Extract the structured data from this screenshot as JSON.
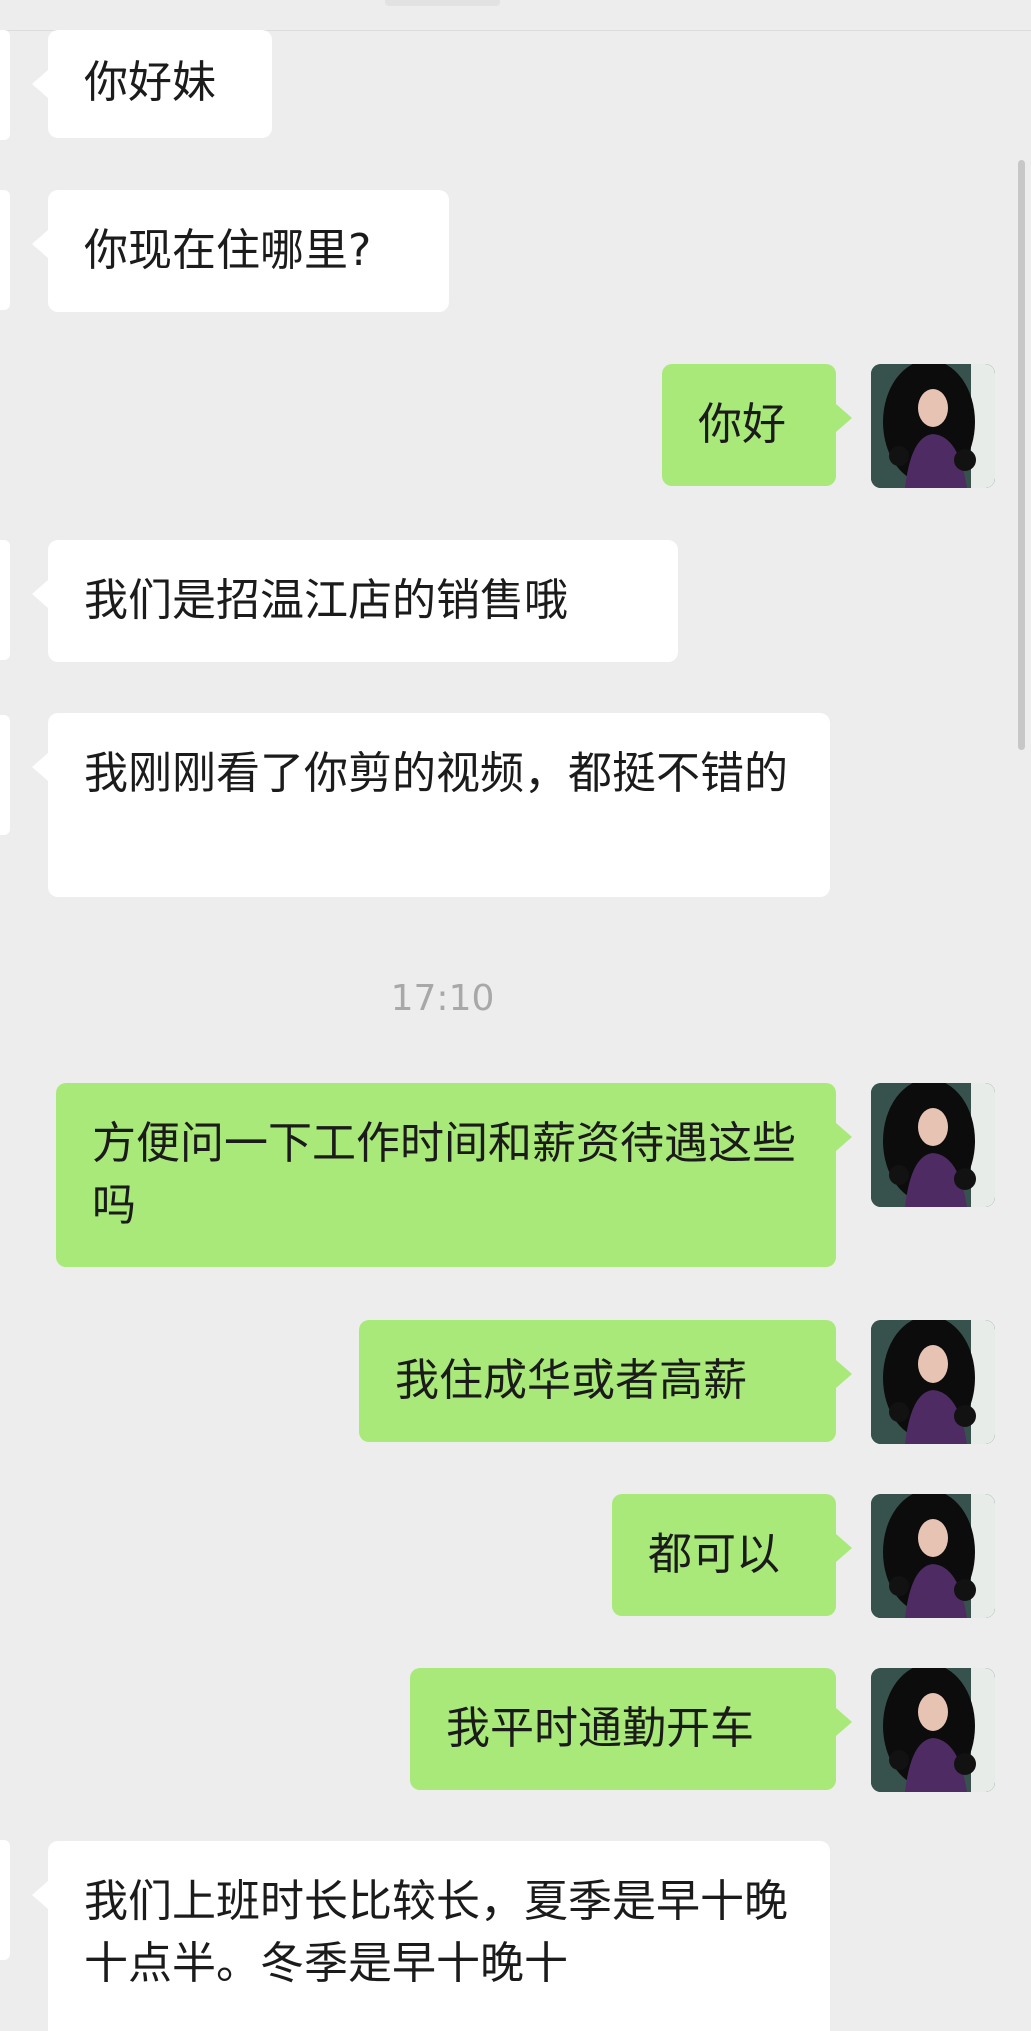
{
  "chat": {
    "messages": [
      {
        "side": "left",
        "text": "你好妹"
      },
      {
        "side": "left",
        "text": "你现在住哪里?"
      },
      {
        "side": "right",
        "text": "你好"
      },
      {
        "side": "left",
        "text": "我们是招温江店的销售哦"
      },
      {
        "side": "left",
        "text": "我刚刚看了你剪的视频，都挺不错的"
      },
      {
        "side": "right",
        "text": "方便问一下工作时间和薪资待遇这些吗"
      },
      {
        "side": "right",
        "text": "我住成华或者高薪"
      },
      {
        "side": "right",
        "text": "都可以"
      },
      {
        "side": "right",
        "text": "我平时通勤开车"
      },
      {
        "side": "left",
        "text": "我们上班时长比较长，夏季是早十晚十点半。冬季是早十晚十"
      }
    ],
    "timestamp": "17:10"
  },
  "colors": {
    "background": "#ededed",
    "incoming_bubble": "#ffffff",
    "outgoing_bubble": "#a9e97a",
    "timestamp_text": "#a8a8a8"
  },
  "icons": {
    "self_avatar": "avatar-photo-woman-purple-dress"
  }
}
